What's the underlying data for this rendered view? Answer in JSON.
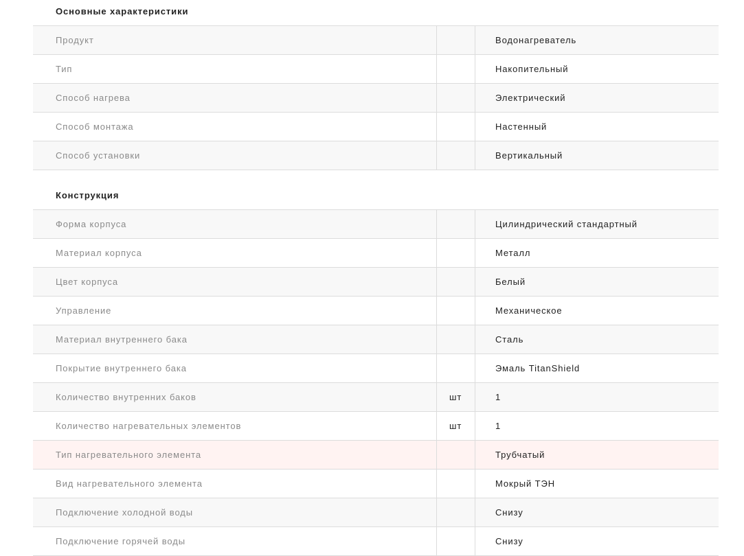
{
  "sections": [
    {
      "title": "Основные характеристики",
      "rows": [
        {
          "name": "Продукт",
          "unit": "",
          "value": "Водонагреватель"
        },
        {
          "name": "Тип",
          "unit": "",
          "value": "Накопительный"
        },
        {
          "name": "Способ нагрева",
          "unit": "",
          "value": "Электрический"
        },
        {
          "name": "Способ монтажа",
          "unit": "",
          "value": "Настенный"
        },
        {
          "name": "Способ установки",
          "unit": "",
          "value": "Вертикальный"
        }
      ]
    },
    {
      "title": "Конструкция",
      "rows": [
        {
          "name": "Форма корпуса",
          "unit": "",
          "value": "Цилиндрический стандартный"
        },
        {
          "name": "Материал корпуса",
          "unit": "",
          "value": "Металл"
        },
        {
          "name": "Цвет корпуса",
          "unit": "",
          "value": "Белый"
        },
        {
          "name": "Управление",
          "unit": "",
          "value": "Механическое"
        },
        {
          "name": "Материал внутреннего бака",
          "unit": "",
          "value": "Сталь"
        },
        {
          "name": "Покрытие внутреннего бака",
          "unit": "",
          "value": "Эмаль TitanShield"
        },
        {
          "name": "Количество внутренних баков",
          "unit": "шт",
          "value": "1"
        },
        {
          "name": "Количество нагревательных элементов",
          "unit": "шт",
          "value": "1"
        },
        {
          "name": "Тип нагревательного элемента",
          "unit": "",
          "value": "Трубчатый"
        },
        {
          "name": "Вид нагревательного элемента",
          "unit": "",
          "value": "Мокрый ТЭН"
        },
        {
          "name": "Подключение холодной воды",
          "unit": "",
          "value": "Снизу"
        },
        {
          "name": "Подключение горячей воды",
          "unit": "",
          "value": "Снизу"
        }
      ]
    }
  ],
  "colors": {
    "label_text": "#8a8a8a",
    "value_text": "#222222",
    "row_shaded": "#f8f8f8",
    "row_highlight": "#fff3f2",
    "divider": "#dcdcdc"
  }
}
